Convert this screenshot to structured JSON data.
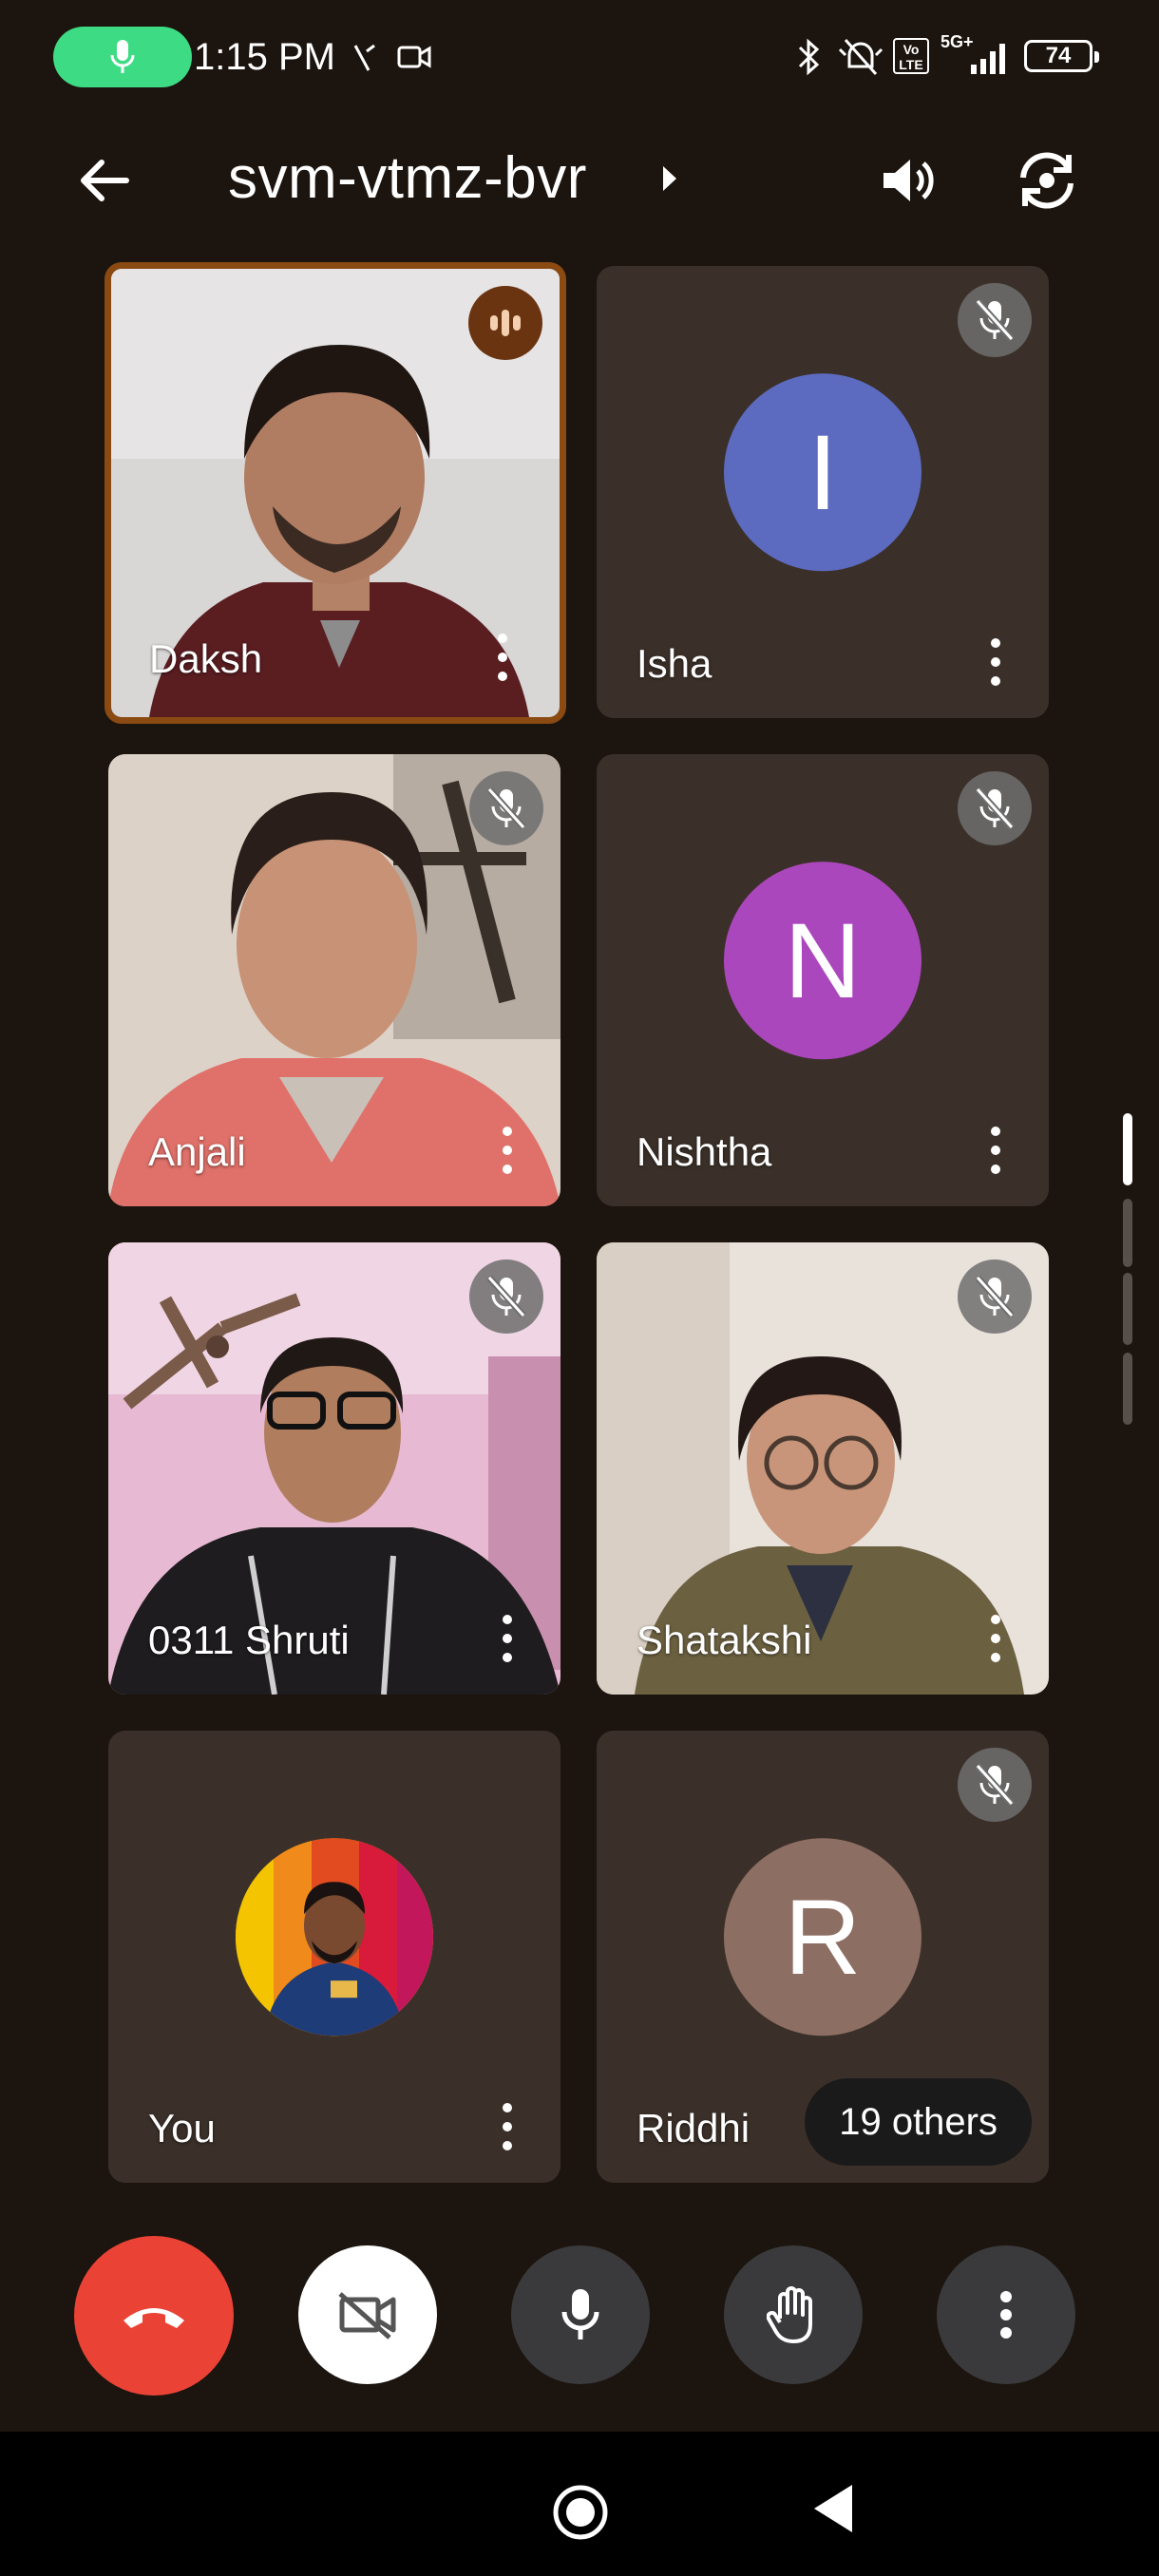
{
  "status_bar": {
    "time": "1:15 PM",
    "battery": "74",
    "network": "5G+",
    "volte": "Vo LTE"
  },
  "app_bar": {
    "meeting_code": "svm-vtmz-bvr",
    "icons": [
      "back-arrow-icon",
      "chevron-right-icon",
      "speaker-icon",
      "switch-camera-icon"
    ]
  },
  "participants": [
    {
      "name": "Daksh",
      "state": "speaking",
      "video": true
    },
    {
      "name": "Isha",
      "initial": "I",
      "avatar_color": "#5c6bc0",
      "muted": true
    },
    {
      "name": "Anjali",
      "video": true,
      "muted": true
    },
    {
      "name": "Nishtha",
      "initial": "N",
      "avatar_color": "#ab47bc",
      "muted": true
    },
    {
      "name": "0311 Shruti",
      "video": true,
      "muted": true
    },
    {
      "name": "Shatakshi",
      "video": true,
      "muted": true
    },
    {
      "name": "You",
      "photo_avatar": true
    },
    {
      "name": "Riddhi",
      "initial": "R",
      "avatar_color": "#8d6e63",
      "muted": true
    }
  ],
  "others_label": "19 others",
  "controls": {
    "colors": {
      "end_call": "#ea4335",
      "camera": "#ffffff",
      "default": "#3a3a3c"
    },
    "icons": [
      "hang-up-icon",
      "camera-off-icon",
      "mic-icon",
      "raise-hand-icon",
      "more-vert-icon"
    ]
  }
}
